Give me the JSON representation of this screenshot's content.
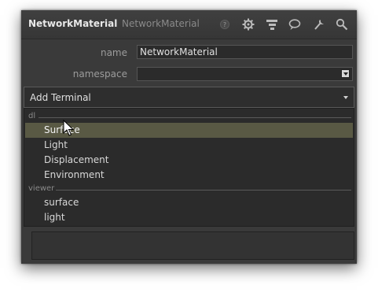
{
  "window": {
    "title": "NetworkMaterial",
    "subtitle": "NetworkMaterial",
    "toolbar_icons": [
      "help-icon",
      "gear-icon",
      "hierarchy-icon",
      "comment-icon",
      "wrench-icon",
      "search-icon"
    ]
  },
  "form": {
    "name_label": "name",
    "name_value": "NetworkMaterial",
    "namespace_label": "namespace",
    "namespace_value": ""
  },
  "add_terminal": {
    "label": "Add Terminal"
  },
  "menu": {
    "sections": [
      {
        "label": "dl",
        "items": [
          "Surface",
          "Light",
          "Displacement",
          "Environment"
        ]
      },
      {
        "label": "viewer",
        "items": [
          "surface",
          "light"
        ]
      }
    ],
    "highlighted": "Surface"
  },
  "colors": {
    "window_bg": "#3a3a3a",
    "menu_bg": "#2b2b2b",
    "highlight": "#595944"
  }
}
